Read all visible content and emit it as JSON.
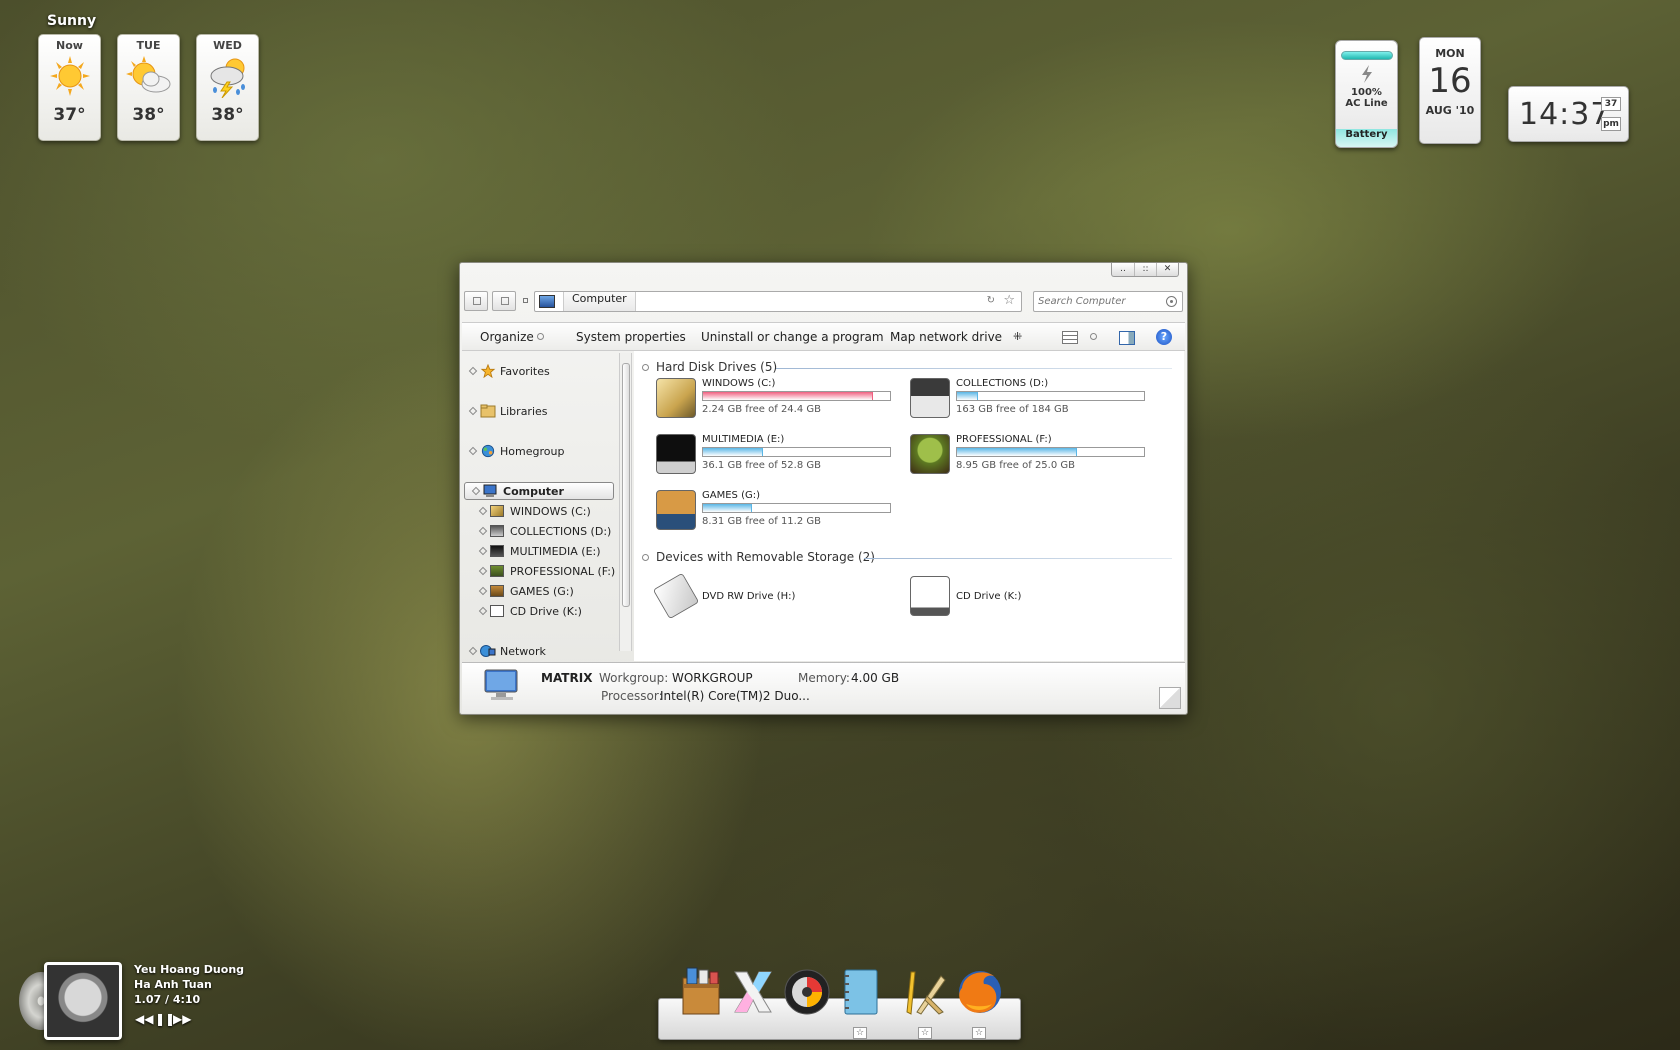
{
  "weather": {
    "title": "Sunny",
    "forecast": [
      {
        "day": "Now",
        "temp": "37°",
        "icon": "sun-icon"
      },
      {
        "day": "TUE",
        "temp": "38°",
        "icon": "partly-cloudy-icon"
      },
      {
        "day": "WED",
        "temp": "38°",
        "icon": "thunderstorm-icon"
      }
    ]
  },
  "battery": {
    "percent": "100%",
    "source": "AC Line",
    "label": "Battery"
  },
  "calendar": {
    "weekday": "MON",
    "date": "16",
    "month": "AUG '10"
  },
  "clock": {
    "time": "14:37",
    "seconds": "37",
    "ampm": "pm"
  },
  "explorer": {
    "window_controls": [
      "..",
      "::",
      "✕"
    ],
    "address": {
      "crumb": "Computer",
      "refresh": "↻",
      "favorite": "☆"
    },
    "search": {
      "placeholder": "Search Computer"
    },
    "toolbar": {
      "organize": "Organize",
      "system_properties": "System properties",
      "uninstall": "Uninstall or change a program",
      "map_drive": "Map network drive",
      "help": "?"
    },
    "nav": {
      "favorites": "Favorites",
      "libraries": "Libraries",
      "homegroup": "Homegroup",
      "computer": "Computer",
      "drives": [
        "WINDOWS (C:)",
        "COLLECTIONS (D:)",
        "MULTIMEDIA (E:)",
        "PROFESSIONAL (F:)",
        "GAMES (G:)",
        "CD Drive (K:)"
      ],
      "network": "Network"
    },
    "hdd_group": "Hard Disk Drives (5)",
    "removable_group": "Devices with Removable Storage (2)",
    "drives": [
      {
        "name": "WINDOWS (C:)",
        "free": "2.24 GB free of 24.4 GB",
        "used_fraction": 0.91,
        "bar_color": "#f06080"
      },
      {
        "name": "COLLECTIONS (D:)",
        "free": "163 GB free of 184 GB",
        "used_fraction": 0.11,
        "bar_color": "#5ab6e6"
      },
      {
        "name": "MULTIMEDIA (E:)",
        "free": "36.1 GB free of 52.8 GB",
        "used_fraction": 0.32,
        "bar_color": "#5ab6e6"
      },
      {
        "name": "PROFESSIONAL (F:)",
        "free": "8.95 GB free of 25.0 GB",
        "used_fraction": 0.64,
        "bar_color": "#5ab6e6"
      },
      {
        "name": "GAMES (G:)",
        "free": "8.31 GB free of 11.2 GB",
        "used_fraction": 0.26,
        "bar_color": "#5ab6e6"
      }
    ],
    "removable": [
      {
        "name": "DVD RW Drive (H:)"
      },
      {
        "name": "CD Drive (K:)"
      }
    ],
    "details": {
      "computer_name": "MATRIX",
      "workgroup_label": "Workgroup:",
      "workgroup": "WORKGROUP",
      "memory_label": "Memory:",
      "memory": "4.00 GB",
      "processor_label": "Processor:",
      "processor": "Intel(R) Core(TM)2 Duo..."
    }
  },
  "media": {
    "title": "Yeu Hoang Duong",
    "artist": "Ha Anh Tuan",
    "time": "1.07 / 4:10"
  },
  "dock": {
    "items": [
      "package-icon",
      "x-app-icon",
      "itunes-icon",
      "notebook-icon",
      "pen-tools-icon",
      "firefox-icon"
    ]
  }
}
